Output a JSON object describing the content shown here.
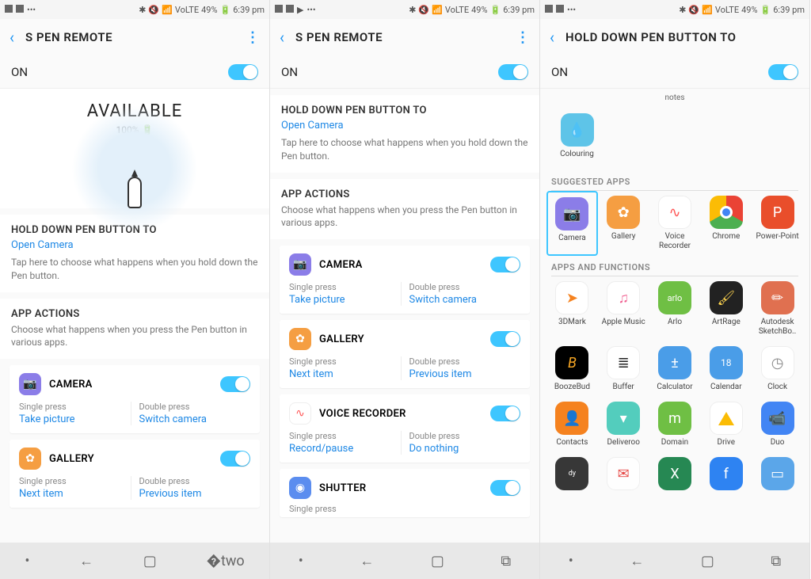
{
  "status": {
    "time": "6:39 pm",
    "battery": "49%",
    "signal": "VoLTE"
  },
  "screen1": {
    "title": "S PEN REMOTE",
    "on": "ON",
    "available": {
      "title": "AVAILABLE",
      "pct": "100%"
    },
    "hold": {
      "header": "HOLD DOWN PEN BUTTON TO",
      "link": "Open Camera",
      "desc": "Tap here to choose what happens when you hold down the Pen button."
    },
    "actions": {
      "header": "APP ACTIONS",
      "desc": "Choose what happens when you press the Pen button in various apps."
    },
    "apps": [
      {
        "name": "CAMERA",
        "single_label": "Single press",
        "single": "Take picture",
        "double_label": "Double press",
        "double": "Switch camera"
      },
      {
        "name": "GALLERY",
        "single_label": "Single press",
        "single": "Next item",
        "double_label": "Double press",
        "double": "Previous item"
      }
    ]
  },
  "screen2": {
    "title": "S PEN REMOTE",
    "on": "ON",
    "hold": {
      "header": "HOLD DOWN PEN BUTTON TO",
      "link": "Open Camera",
      "desc": "Tap here to choose what happens when you hold down the Pen button."
    },
    "actions": {
      "header": "APP ACTIONS",
      "desc": "Choose what happens when you press the Pen button in various apps."
    },
    "apps": [
      {
        "name": "CAMERA",
        "single_label": "Single press",
        "single": "Take picture",
        "double_label": "Double press",
        "double": "Switch camera"
      },
      {
        "name": "GALLERY",
        "single_label": "Single press",
        "single": "Next item",
        "double_label": "Double press",
        "double": "Previous item"
      },
      {
        "name": "VOICE RECORDER",
        "single_label": "Single press",
        "single": "Record/pause",
        "double_label": "Double press",
        "double": "Do nothing"
      },
      {
        "name": "SHUTTER",
        "single_label": "Single press",
        "single": "",
        "double_label": "",
        "double": ""
      }
    ]
  },
  "screen3": {
    "title": "HOLD DOWN PEN BUTTON TO",
    "on": "ON",
    "notes": "notes",
    "colouring": "Colouring",
    "suggested_label": "SUGGESTED APPS",
    "suggested": [
      {
        "name": "Camera"
      },
      {
        "name": "Gallery"
      },
      {
        "name": "Voice Recorder"
      },
      {
        "name": "Chrome"
      },
      {
        "name": "Power-Point"
      }
    ],
    "apps_label": "APPS AND FUNCTIONS",
    "apps_rows": [
      [
        {
          "name": "3DMark"
        },
        {
          "name": "Apple Music"
        },
        {
          "name": "Arlo"
        },
        {
          "name": "ArtRage"
        },
        {
          "name": "Autodesk SketchBo.."
        }
      ],
      [
        {
          "name": "BoozeBud"
        },
        {
          "name": "Buffer"
        },
        {
          "name": "Calculator"
        },
        {
          "name": "Calendar"
        },
        {
          "name": "Clock"
        }
      ],
      [
        {
          "name": "Contacts"
        },
        {
          "name": "Deliveroo"
        },
        {
          "name": "Domain"
        },
        {
          "name": "Drive"
        },
        {
          "name": "Duo"
        }
      ]
    ]
  },
  "icon_colors": {
    "camera": "#8b7de8",
    "gallery": "#f59e42",
    "voice": "#fff",
    "shutter": "#5b8def",
    "colouring": "#5ec4e8",
    "chrome": "#fff",
    "powerpoint": "#e94e2b",
    "3dmark": "#fff",
    "applemusic": "#fff",
    "arlo": "#6fbf44",
    "artrage": "#222",
    "sketchbook": "#e07050",
    "boozebud": "#000",
    "buffer": "#fff",
    "calculator": "#4a9de8",
    "calendar": "#4a9de8",
    "clock": "#fff",
    "contacts": "#f5821f",
    "deliveroo": "#53cdbd",
    "domain": "#6fbf44",
    "drive": "#fff",
    "duo": "#4285f4"
  }
}
